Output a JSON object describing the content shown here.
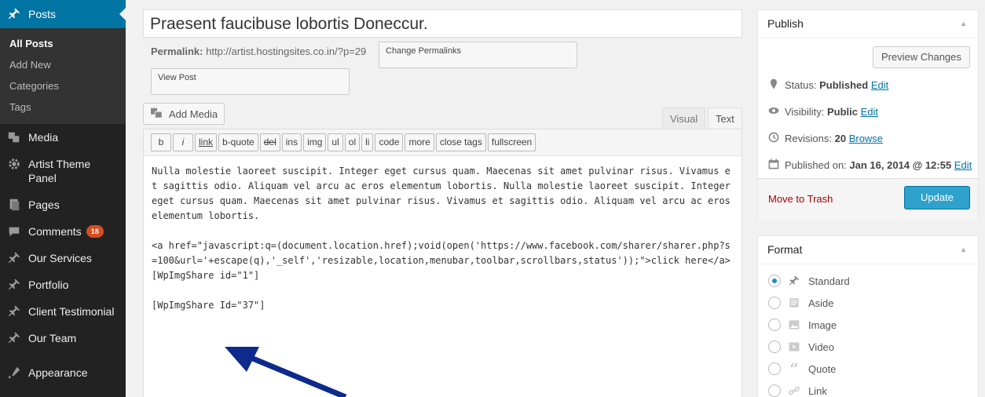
{
  "sidebar": {
    "posts": "Posts",
    "sub": [
      "All Posts",
      "Add New",
      "Categories",
      "Tags"
    ],
    "items": [
      {
        "label": "Media",
        "icon": "media-icon"
      },
      {
        "label": "Artist Theme\nPanel",
        "icon": "gear-icon"
      },
      {
        "label": "Pages",
        "icon": "pages-icon"
      },
      {
        "label": "Comments",
        "icon": "comments-icon",
        "badge": "18"
      },
      {
        "label": "Our Services",
        "icon": "pin-icon"
      },
      {
        "label": "Portfolio",
        "icon": "pin-icon"
      },
      {
        "label": "Client Testimonial",
        "icon": "pin-icon"
      },
      {
        "label": "Our Team",
        "icon": "pin-icon"
      },
      {
        "label": "Appearance",
        "icon": "appearance-icon"
      }
    ],
    "comments_badge": "18"
  },
  "post": {
    "title": "Praesent faucibuse lobortis Doneccur.",
    "permalink_label": "Permalink:",
    "permalink_url": "http://artist.hostingsites.co.in/?p=29",
    "change_permalinks": "Change Permalinks",
    "view_post": "View Post"
  },
  "editor": {
    "add_media": "Add Media",
    "tab_visual": "Visual",
    "tab_text": "Text",
    "buttons": [
      "b",
      "i",
      "link",
      "b-quote",
      "del",
      "ins",
      "img",
      "ul",
      "ol",
      "li",
      "code",
      "more",
      "close tags",
      "fullscreen"
    ],
    "content": [
      "Nulla molestie laoreet suscipit. Integer eget cursus quam. Maecenas sit amet pulvinar risus. Vivamus et sagittis odio. Aliquam vel arcu ac eros elementum lobortis. Nulla molestie laoreet suscipit. Integer eget cursus quam. Maecenas sit amet pulvinar risus. Vivamus et sagittis odio. Aliquam vel arcu ac eros elementum lobortis.",
      "<a href=\"javascript:q=(document.location.href);void(open('https://www.facebook.com/sharer/sharer.php?s=100&url='+escape(q),'_self','resizable,location,menubar,toolbar,scrollbars,status'));\">click here</a>\n[WpImgShare id=\"1\"]",
      "[WpImgShare Id=\"37\"]"
    ]
  },
  "publish": {
    "title": "Publish",
    "preview": "Preview Changes",
    "status_label": "Status:",
    "status_value": "Published",
    "visibility_label": "Visibility:",
    "visibility_value": "Public",
    "revisions_label": "Revisions:",
    "revisions_value": "20",
    "published_label": "Published on:",
    "published_value": "Jan 16, 2014 @ 12:55",
    "edit": "Edit",
    "browse": "Browse",
    "trash": "Move to Trash",
    "update": "Update"
  },
  "format": {
    "title": "Format",
    "options": [
      {
        "label": "Standard",
        "icon": "pin-icon",
        "checked": true
      },
      {
        "label": "Aside",
        "icon": "aside-icon",
        "checked": false
      },
      {
        "label": "Image",
        "icon": "image-icon",
        "checked": false
      },
      {
        "label": "Video",
        "icon": "video-icon",
        "checked": false
      },
      {
        "label": "Quote",
        "icon": "quote-icon",
        "checked": false
      },
      {
        "label": "Link",
        "icon": "link-icon",
        "checked": false
      }
    ]
  },
  "colors": {
    "accent": "#0074a2",
    "sidebar": "#222222",
    "update_button": "#2ea2cc",
    "annotation_arrow": "#0d2a8c"
  }
}
